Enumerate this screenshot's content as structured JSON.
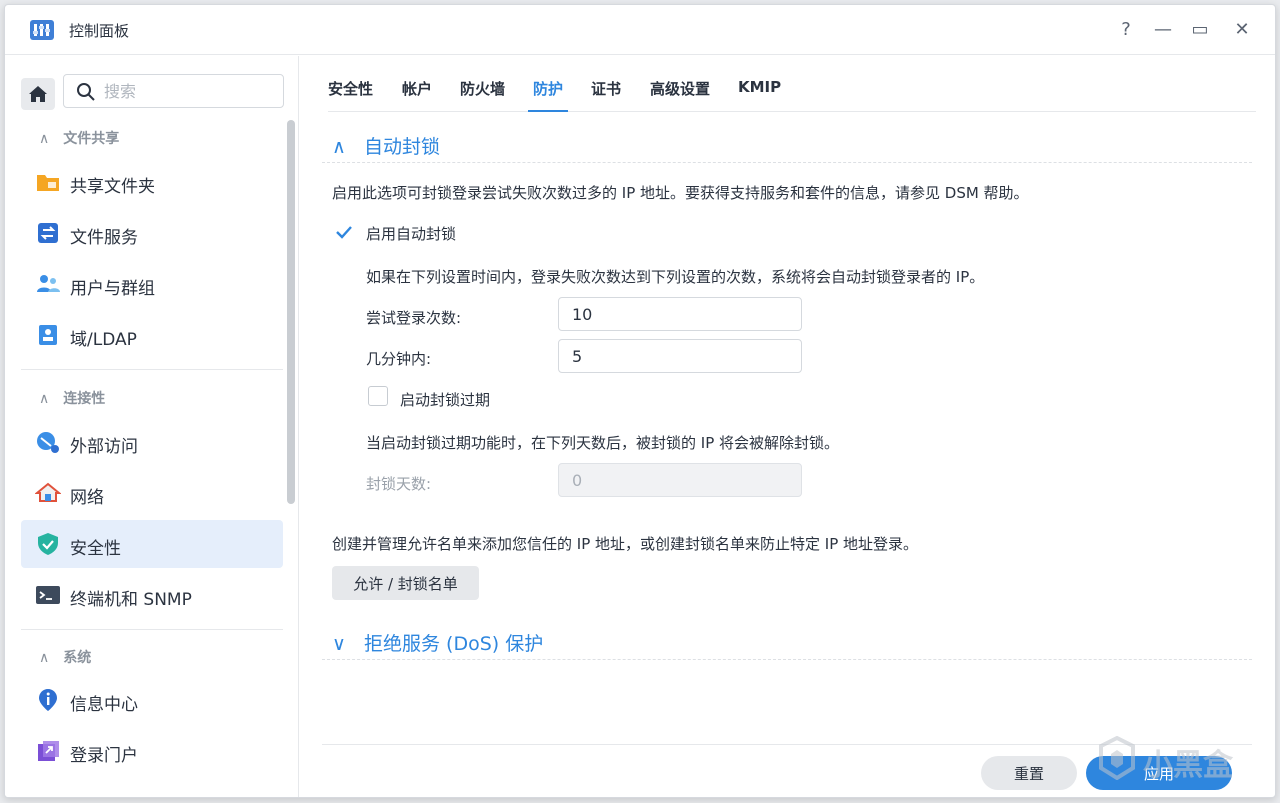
{
  "window": {
    "title": "控制面板",
    "controls": {
      "help": "?",
      "minimize": "—",
      "maximize": "▭",
      "close": "✕"
    }
  },
  "sidebar": {
    "search_placeholder": "搜索",
    "sections": [
      {
        "title": "文件共享",
        "items": [
          "共享文件夹",
          "文件服务",
          "用户与群组",
          "域/LDAP"
        ]
      },
      {
        "title": "连接性",
        "items": [
          "外部访问",
          "网络",
          "安全性",
          "终端机和 SNMP"
        ]
      },
      {
        "title": "系统",
        "items": [
          "信息中心",
          "登录门户"
        ]
      }
    ],
    "active_item": "安全性"
  },
  "tabs": [
    "安全性",
    "帐户",
    "防火墙",
    "防护",
    "证书",
    "高级设置",
    "KMIP"
  ],
  "active_tab": "防护",
  "auto_block": {
    "title": "自动封锁",
    "description": "启用此选项可封锁登录尝试失败次数过多的 IP 地址。要获得支持服务和套件的信息，请参见 DSM 帮助。",
    "enable_label": "启用自动封锁",
    "enable_checked": true,
    "rule_text": "如果在下列设置时间内，登录失败次数达到下列设置的次数，系统将会自动封锁登录者的 IP。",
    "attempts_label": "尝试登录次数:",
    "attempts_value": "10",
    "minutes_label": "几分钟内:",
    "minutes_value": "5",
    "expire_label": "启动封锁过期",
    "expire_checked": false,
    "expire_text": "当启动封锁过期功能时，在下列天数后，被封锁的 IP 将会被解除封锁。",
    "days_label": "封锁天数:",
    "days_value": "0"
  },
  "allowlist": {
    "text": "创建并管理允许名单来添加您信任的 IP 地址，或创建封锁名单来防止特定 IP 地址登录。",
    "button": "允许 / 封锁名单"
  },
  "dos": {
    "title": "拒绝服务 (DoS) 保护"
  },
  "footer": {
    "reset": "重置",
    "apply": "应用"
  },
  "watermark": "小黑盒",
  "colors": {
    "accent": "#2e86de",
    "active_bg": "#e5eefb",
    "text": "#2b3340"
  }
}
